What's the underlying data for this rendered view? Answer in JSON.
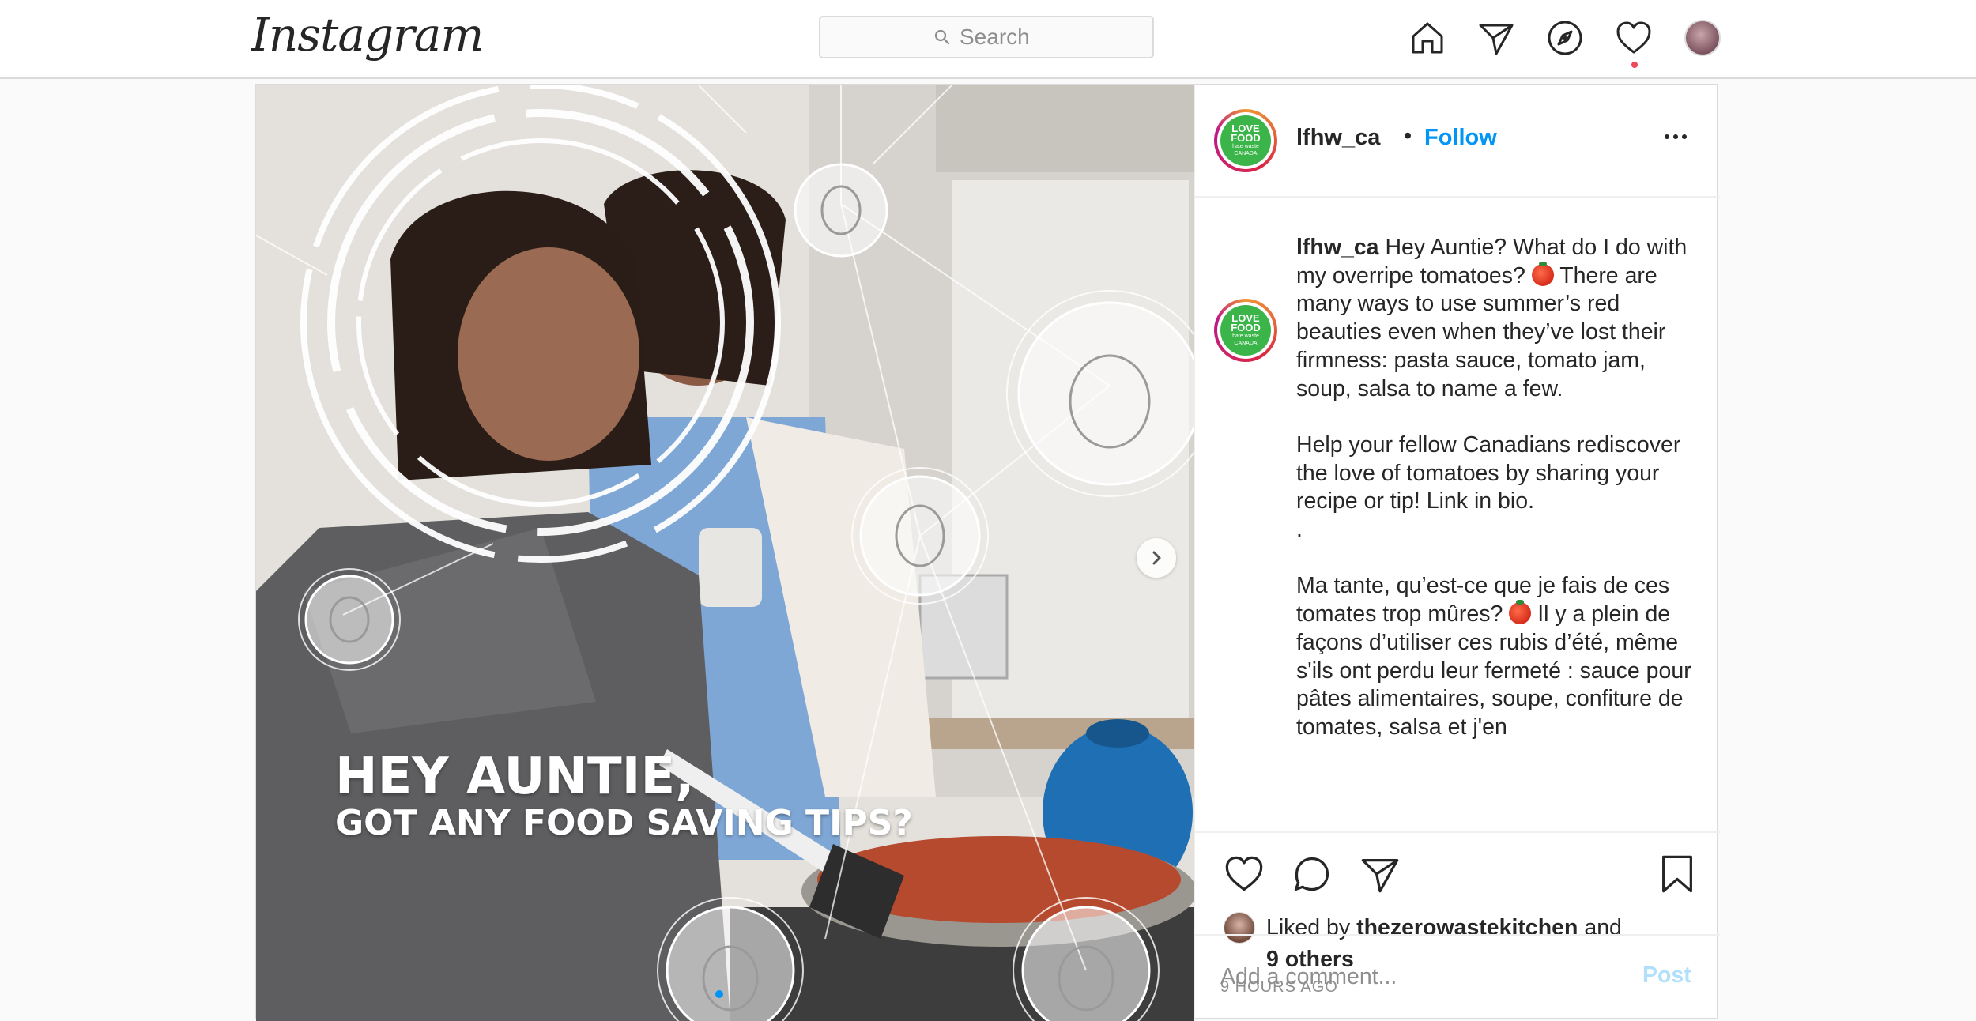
{
  "nav": {
    "logo": "Instagram",
    "search_placeholder": "Search",
    "icons": [
      "home-icon",
      "direct-icon",
      "explore-icon",
      "activity-heart-icon",
      "profile-avatar"
    ]
  },
  "post": {
    "image_overlay": {
      "line1": "HEY AUNTIE,",
      "line2": "GOT ANY FOOD SAVING TIPS?"
    },
    "header": {
      "username": "lfhw_ca",
      "separator": "•",
      "follow_label": "Follow",
      "avatar_text_line1": "LOVE",
      "avatar_text_line2": "FOOD",
      "avatar_text_line3": "hate waste",
      "avatar_text_line4": "CANADA"
    },
    "caption": {
      "username": "lfhw_ca",
      "p1_a": "Hey Auntie? What do I do with my overripe tomatoes?",
      "p1_b": "There are many ways to use summer’s red beauties even when they’ve lost their firmness: pasta sauce, tomato jam, soup, salsa to name a few.",
      "p2": "Help your fellow Canadians rediscover the love of tomatoes by sharing your recipe or tip! Link in bio.",
      "p3": ".",
      "p4_a": "Ma tante, qu’est-ce que je fais de ces tomates trop mûres?",
      "p4_b": "Il y a plein de façons d’utiliser ces rubis d’été, même s'ils ont perdu leur fermeté : sauce pour pâtes alimentaires, soupe, confiture de tomates, salsa et j'en"
    },
    "likes": {
      "prefix": "Liked by",
      "user": "thezerowastekitchen",
      "conj": "and",
      "others": "9 others"
    },
    "time": "9 HOURS AGO",
    "comment": {
      "placeholder": "Add a comment...",
      "post_label": "Post"
    },
    "colors": {
      "accent": "#0095f6",
      "post_disabled": "#b2dffc",
      "notification_dot": "#ed4956",
      "brand_green": "#3bb54a"
    }
  }
}
